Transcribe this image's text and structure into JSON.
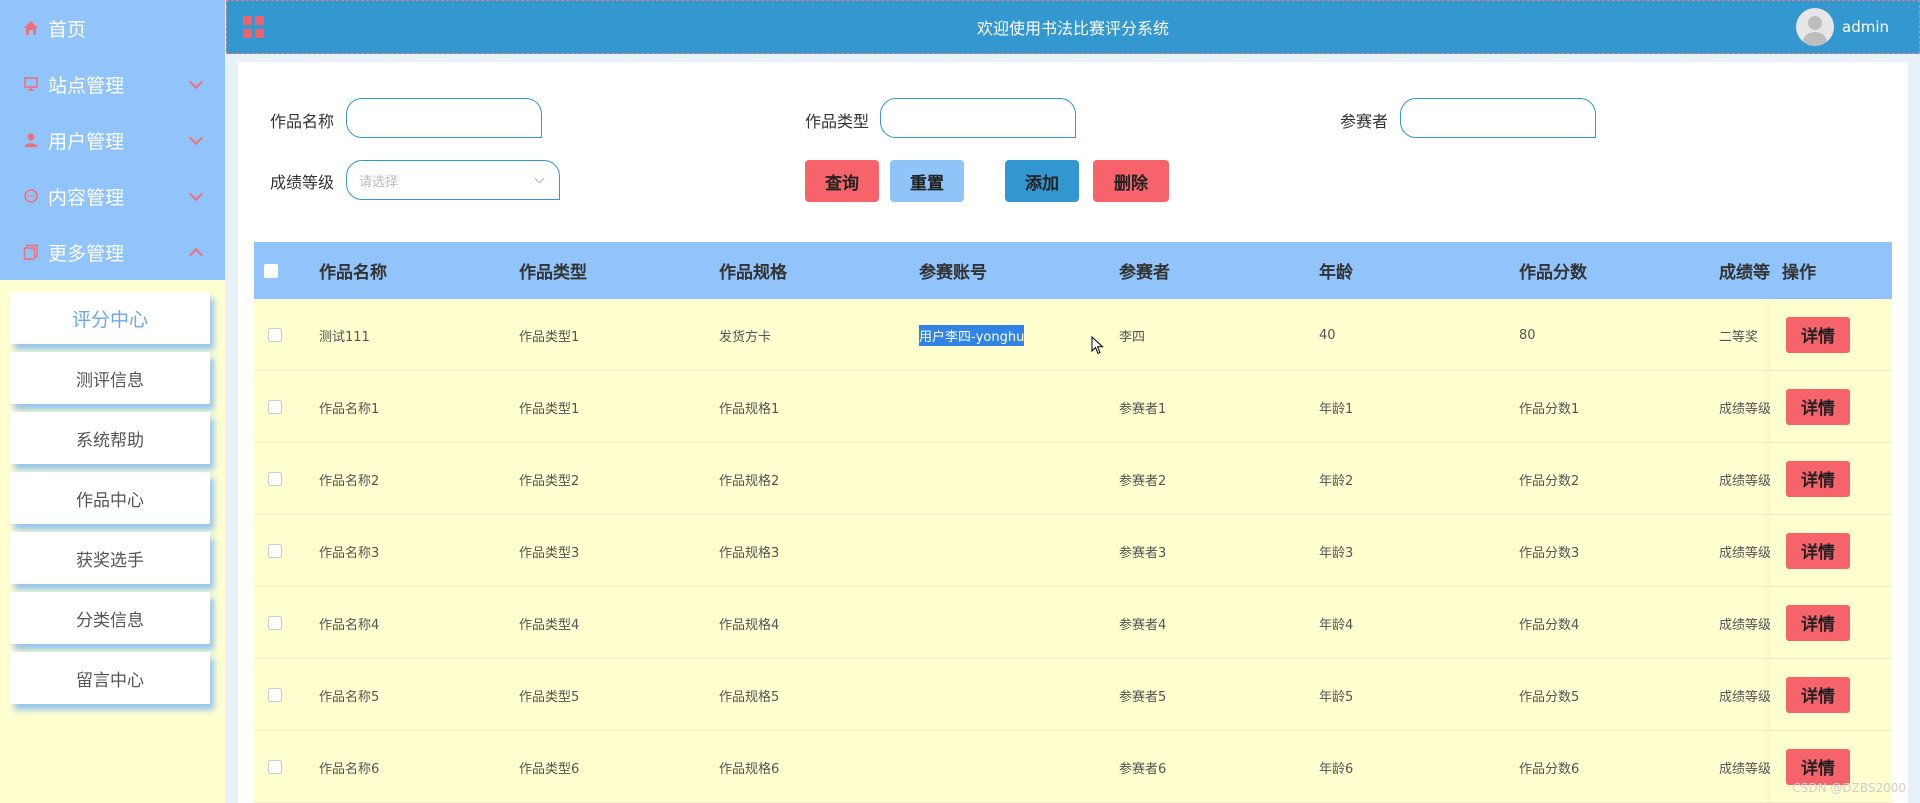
{
  "header": {
    "title": "欢迎使用书法比赛评分系统",
    "username": "admin"
  },
  "sidebar": {
    "menu": [
      {
        "label": "首页",
        "icon": "home-icon"
      },
      {
        "label": "站点管理",
        "icon": "monitor-icon"
      },
      {
        "label": "用户管理",
        "icon": "user-icon"
      },
      {
        "label": "内容管理",
        "icon": "chat-icon"
      },
      {
        "label": "更多管理",
        "icon": "copy-icon"
      }
    ],
    "submenu": [
      {
        "label": "评分中心",
        "active": true
      },
      {
        "label": "测评信息"
      },
      {
        "label": "系统帮助"
      },
      {
        "label": "作品中心"
      },
      {
        "label": "获奖选手"
      },
      {
        "label": "分类信息"
      },
      {
        "label": "留言中心"
      }
    ]
  },
  "filters": {
    "work_name_label": "作品名称",
    "work_type_label": "作品类型",
    "participant_label": "参赛者",
    "grade_label": "成绩等级",
    "grade_placeholder": "请选择"
  },
  "buttons": {
    "query": "查询",
    "reset": "重置",
    "add": "添加",
    "delete": "删除"
  },
  "table": {
    "columns": [
      "作品名称",
      "作品类型",
      "作品规格",
      "参赛账号",
      "参赛者",
      "年龄",
      "作品分数",
      "成绩等级",
      "操作"
    ],
    "rows": [
      [
        "测试111",
        "作品类型1",
        "发货方卡",
        "用户李四-yonghu",
        "李四",
        "40",
        "80",
        "二等奖"
      ],
      [
        "作品名称1",
        "作品类型1",
        "作品规格1",
        "",
        "参赛者1",
        "年龄1",
        "作品分数1",
        "成绩等级"
      ],
      [
        "作品名称2",
        "作品类型2",
        "作品规格2",
        "",
        "参赛者2",
        "年龄2",
        "作品分数2",
        "成绩等级"
      ],
      [
        "作品名称3",
        "作品类型3",
        "作品规格3",
        "",
        "参赛者3",
        "年龄3",
        "作品分数3",
        "成绩等级"
      ],
      [
        "作品名称4",
        "作品类型4",
        "作品规格4",
        "",
        "参赛者4",
        "年龄4",
        "作品分数4",
        "成绩等级"
      ],
      [
        "作品名称5",
        "作品类型5",
        "作品规格5",
        "",
        "参赛者5",
        "年龄5",
        "作品分数5",
        "成绩等级"
      ],
      [
        "作品名称6",
        "作品类型6",
        "作品规格6",
        "",
        "参赛者6",
        "年龄6",
        "作品分数6",
        "成绩等级"
      ]
    ],
    "detail_label": "详情"
  },
  "watermark": "CSDN @DZBS2000",
  "colors": {
    "header_bg": "#3498d0",
    "sidebar_menu_bg": "#90c4fa",
    "sidebar_bg": "#ffffd0",
    "table_header_bg": "#90c4fa",
    "row_bg": "#ffffd0",
    "danger": "#f6636b",
    "primary": "#3296d0",
    "light_primary": "#8ec4f7"
  }
}
